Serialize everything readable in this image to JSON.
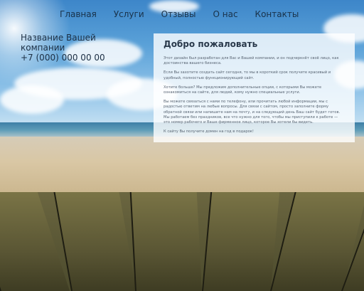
{
  "nav": {
    "items": [
      "Главная",
      "Услуги",
      "Отзывы",
      "О нас",
      "Контакты"
    ]
  },
  "company": {
    "name": "Название Вашей компании",
    "phone": "+7 (000) 000 00 00"
  },
  "welcome": {
    "title": "Добро пожаловать",
    "paragraphs": [
      "Этот дизайн был разработан для Вас и Вашей компании, и он подчеркнёт своё лицо, как достоинства вашего бизнеса.",
      "Если Вы захотите создать сайт сегодня, то мы в короткий срок получите красивый и удобный, полностью функционирующий сайт.",
      "Хотите больше? Мы предложим дополнительные опции, с которыми Вы можете ознакомиться на сайте, для людей, кому нужно специальные услуги.",
      "Вы можете связаться с нами по телефону, или прочитать любой информации, мы с радостью ответим на любые вопросы. Для связи с сайтом, просто заполните форму обратной связи или напишите нам на почту, и на следующий день Ваш сайт будет готов. Мы работаем без праздников, все что нужно для того, чтобы мы приступили к работе — это номер рабочего и Ваше фирменное лицо, которое Вы хотели бы видеть.",
      "К сайту Вы получите домен на год в подарок!"
    ]
  },
  "colors": {
    "nav_text": "#19324a",
    "panel_bg": "rgba(255,255,255,0.8)"
  }
}
